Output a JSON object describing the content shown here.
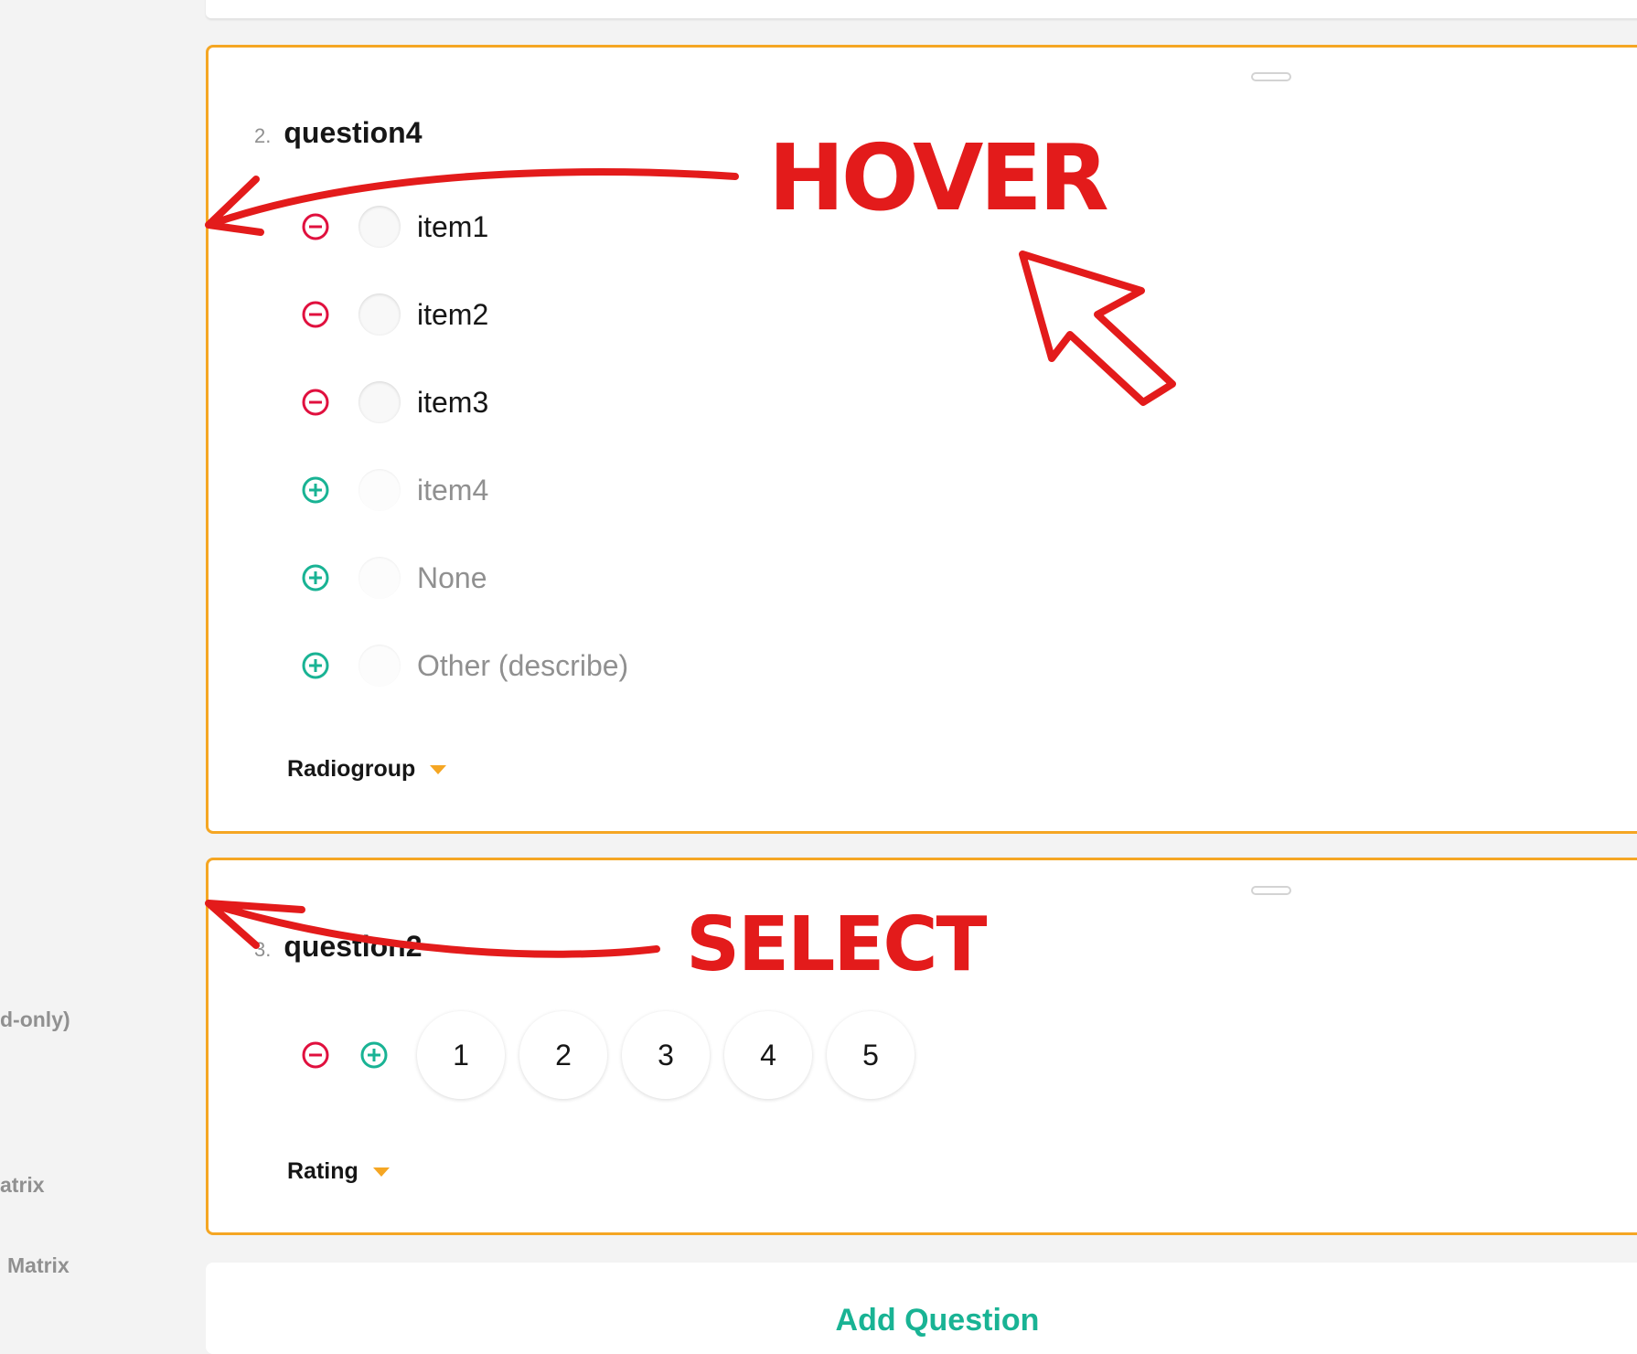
{
  "sidebar": {
    "items": [
      "d-only)",
      "atrix",
      "Matrix"
    ]
  },
  "questions": [
    {
      "number": "2.",
      "name": "question4",
      "type": "Radiogroup",
      "choices": [
        {
          "label": "item1",
          "icon": "remove-circle-icon",
          "active": true
        },
        {
          "label": "item2",
          "icon": "remove-circle-icon",
          "active": true
        },
        {
          "label": "item3",
          "icon": "remove-circle-icon",
          "active": true
        },
        {
          "label": "item4",
          "icon": "add-circle-icon",
          "active": false
        },
        {
          "label": "None",
          "icon": "add-circle-icon",
          "active": false
        },
        {
          "label": "Other (describe)",
          "icon": "add-circle-icon",
          "active": false
        }
      ]
    },
    {
      "number": "3.",
      "name": "question2",
      "type": "Rating",
      "rating_values": [
        "1",
        "2",
        "3",
        "4",
        "5"
      ]
    }
  ],
  "add_question_label": "Add Question",
  "annotations": {
    "hover": "HOVER",
    "select": "SELECT"
  },
  "colors": {
    "accent_orange": "#f5a623",
    "remove_red": "#e0103e",
    "add_green": "#19b394",
    "annotation_red": "#e31b1b"
  }
}
